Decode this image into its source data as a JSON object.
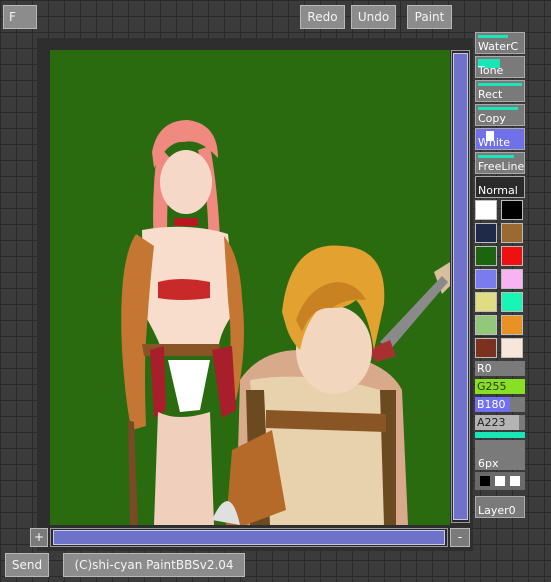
{
  "toolbar": {
    "menu_label": "F",
    "redo_label": "Redo",
    "undo_label": "Undo",
    "paint_label": "Paint"
  },
  "tools": [
    {
      "label": "WaterC"
    },
    {
      "label": "Tone"
    },
    {
      "label": "Rect"
    },
    {
      "label": "Copy"
    },
    {
      "label": "White"
    },
    {
      "label": "FreeLine"
    },
    {
      "label": "Normal"
    }
  ],
  "palette": [
    "#ffffff",
    "#000000",
    "#1f2a48",
    "#9a6a32",
    "#1d6410",
    "#ee1111",
    "#7b7bf0",
    "#f7b3f2",
    "#e0dc83",
    "#18f5b6",
    "#93c87a",
    "#e89225",
    "#7b3020",
    "#f8e6da"
  ],
  "sliders": {
    "r": {
      "label": "R0",
      "value": 0,
      "color": "#ff4040"
    },
    "g": {
      "label": "G255",
      "value": 255,
      "color": "#88e024"
    },
    "b": {
      "label": "B180",
      "value": 180,
      "color": "#7070f0"
    },
    "a": {
      "label": "A223",
      "value": 223,
      "color": "#b4b4b4"
    }
  },
  "brush": {
    "size_label": "6px"
  },
  "layer": {
    "label": "Layer0"
  },
  "canvas": {
    "background": "#2a6b10"
  },
  "footer": {
    "send_label": "Send",
    "copyright": "(C)shi-cyan PaintBBSv2.04"
  },
  "zoom": {
    "plus": "+",
    "minus": "-"
  }
}
